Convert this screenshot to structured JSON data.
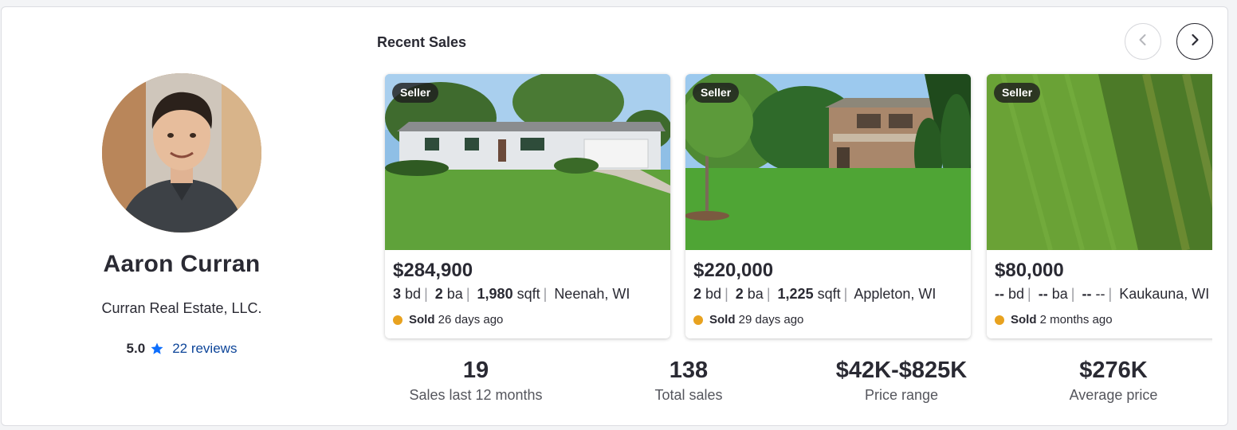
{
  "agent": {
    "name": "Aaron Curran",
    "company": "Curran Real Estate, LLC.",
    "rating": "5.0",
    "reviews_label": "22 reviews"
  },
  "recent_sales": {
    "title": "Recent Sales",
    "listings": [
      {
        "badge": "Seller",
        "price": "$284,900",
        "beds": "3",
        "beds_unit": "bd",
        "baths": "2",
        "baths_unit": "ba",
        "sqft": "1,980",
        "sqft_unit": "sqft",
        "location": "Neenah, WI",
        "sold_label": "Sold",
        "sold_ago": "26 days ago"
      },
      {
        "badge": "Seller",
        "price": "$220,000",
        "beds": "2",
        "beds_unit": "bd",
        "baths": "2",
        "baths_unit": "ba",
        "sqft": "1,225",
        "sqft_unit": "sqft",
        "location": "Appleton, WI",
        "sold_label": "Sold",
        "sold_ago": "29 days ago"
      },
      {
        "badge": "Seller",
        "price": "$80,000",
        "beds": "--",
        "beds_unit": "bd",
        "baths": "--",
        "baths_unit": "ba",
        "sqft": "--",
        "sqft_unit": "--",
        "location": "Kaukauna, WI",
        "sold_label": "Sold",
        "sold_ago": "2 months ago"
      }
    ]
  },
  "stats": [
    {
      "value": "19",
      "label": "Sales last 12 months"
    },
    {
      "value": "138",
      "label": "Total sales"
    },
    {
      "value": "$42K-$825K",
      "label": "Price range"
    },
    {
      "value": "$276K",
      "label": "Average price"
    }
  ],
  "icons": {
    "rating_star": "star-icon",
    "prev": "chevron-left-icon",
    "next": "chevron-right-icon",
    "sold_status": "status-dot-icon"
  },
  "colors": {
    "star": "#0d6efd",
    "link": "#0d4599",
    "sold_dot": "#e8a21f",
    "text": "#2a2a33"
  }
}
